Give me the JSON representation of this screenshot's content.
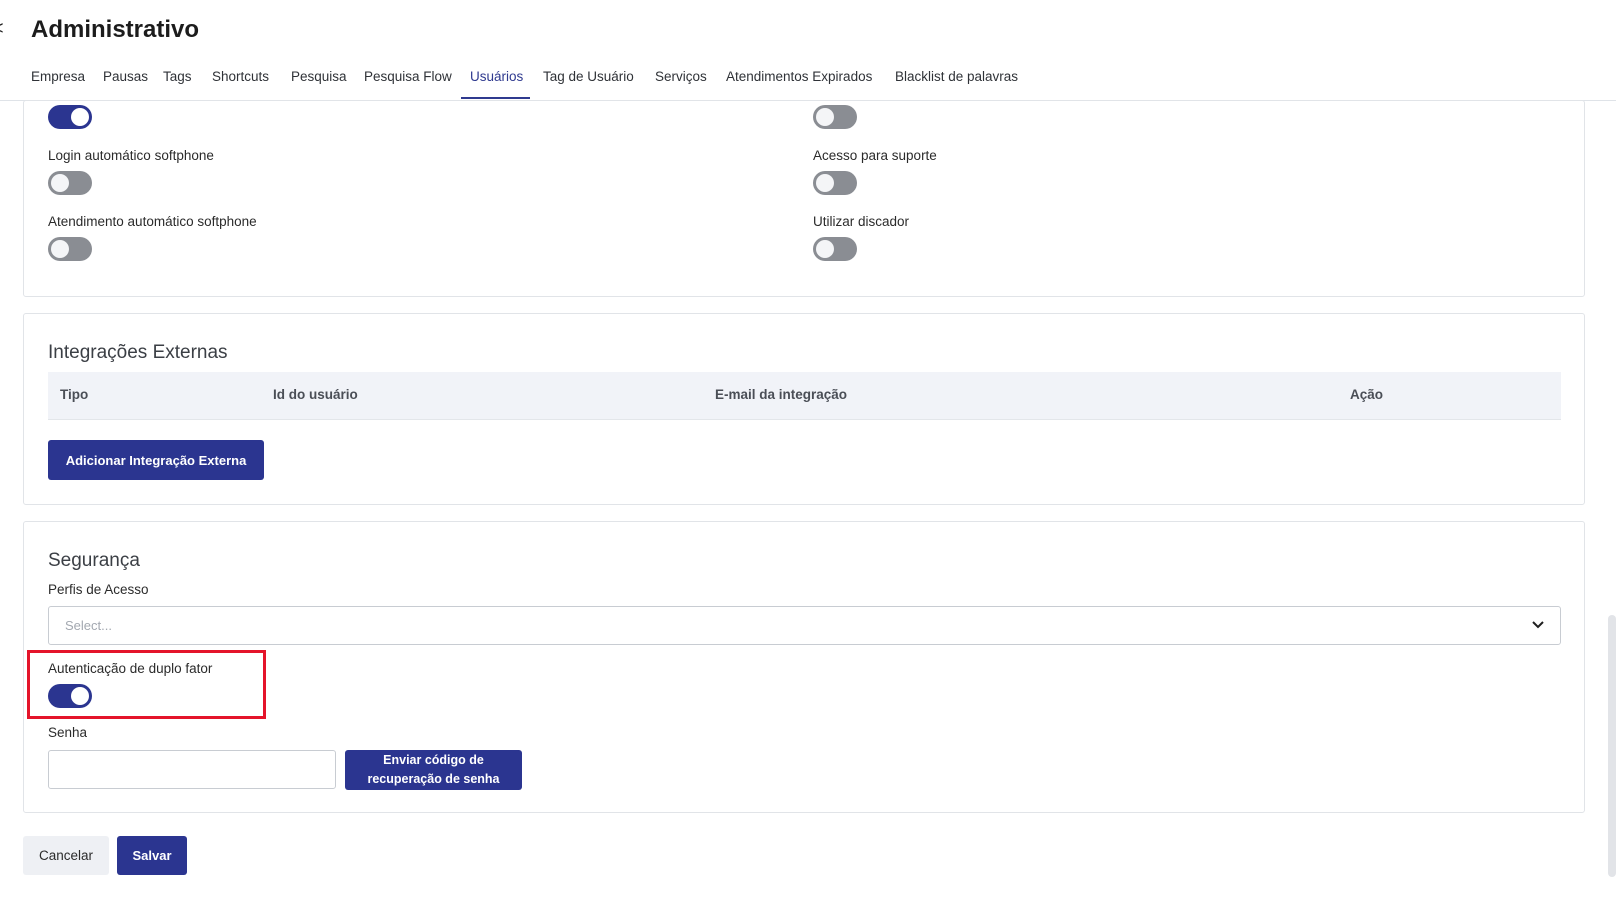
{
  "page": {
    "title": "Administrativo",
    "back_glyph": "<"
  },
  "tabs": [
    {
      "label": "Empresa"
    },
    {
      "label": "Pausas"
    },
    {
      "label": "Tags"
    },
    {
      "label": "Shortcuts"
    },
    {
      "label": "Pesquisa"
    },
    {
      "label": "Pesquisa Flow"
    },
    {
      "label": "Usuários"
    },
    {
      "label": "Tag de Usuário"
    },
    {
      "label": "Serviços"
    },
    {
      "label": "Atendimentos Expirados"
    },
    {
      "label": "Blacklist de palavras"
    }
  ],
  "active_tab": "Usuários",
  "settings": {
    "left": [
      {
        "label": "",
        "on": true
      },
      {
        "label": "Login automático softphone",
        "on": false
      },
      {
        "label": "Atendimento automático softphone",
        "on": false
      }
    ],
    "right": [
      {
        "label": "",
        "on": false
      },
      {
        "label": "Acesso para suporte",
        "on": false
      },
      {
        "label": "Utilizar discador",
        "on": false
      }
    ]
  },
  "integrations": {
    "title": "Integrações Externas",
    "columns": [
      "Tipo",
      "Id do usuário",
      "E-mail da integração",
      "Ação"
    ],
    "rows": [],
    "add_button": "Adicionar Integração Externa"
  },
  "security": {
    "title": "Segurança",
    "profiles_label": "Perfis de Acesso",
    "profiles_placeholder": "Select...",
    "two_factor_label": "Autenticação de duplo fator",
    "two_factor_on": true,
    "password_label": "Senha",
    "password_value": "",
    "recovery_button_line1": "Enviar código de",
    "recovery_button_line2": "recuperação de senha"
  },
  "footer": {
    "cancel_label": "Cancelar",
    "save_label": "Salvar"
  },
  "colors": {
    "primary": "#2b3590",
    "highlight": "#e4142a",
    "toggle_off": "#8a8d93"
  },
  "icons": {
    "select_arrow": "chevron-down-icon"
  }
}
